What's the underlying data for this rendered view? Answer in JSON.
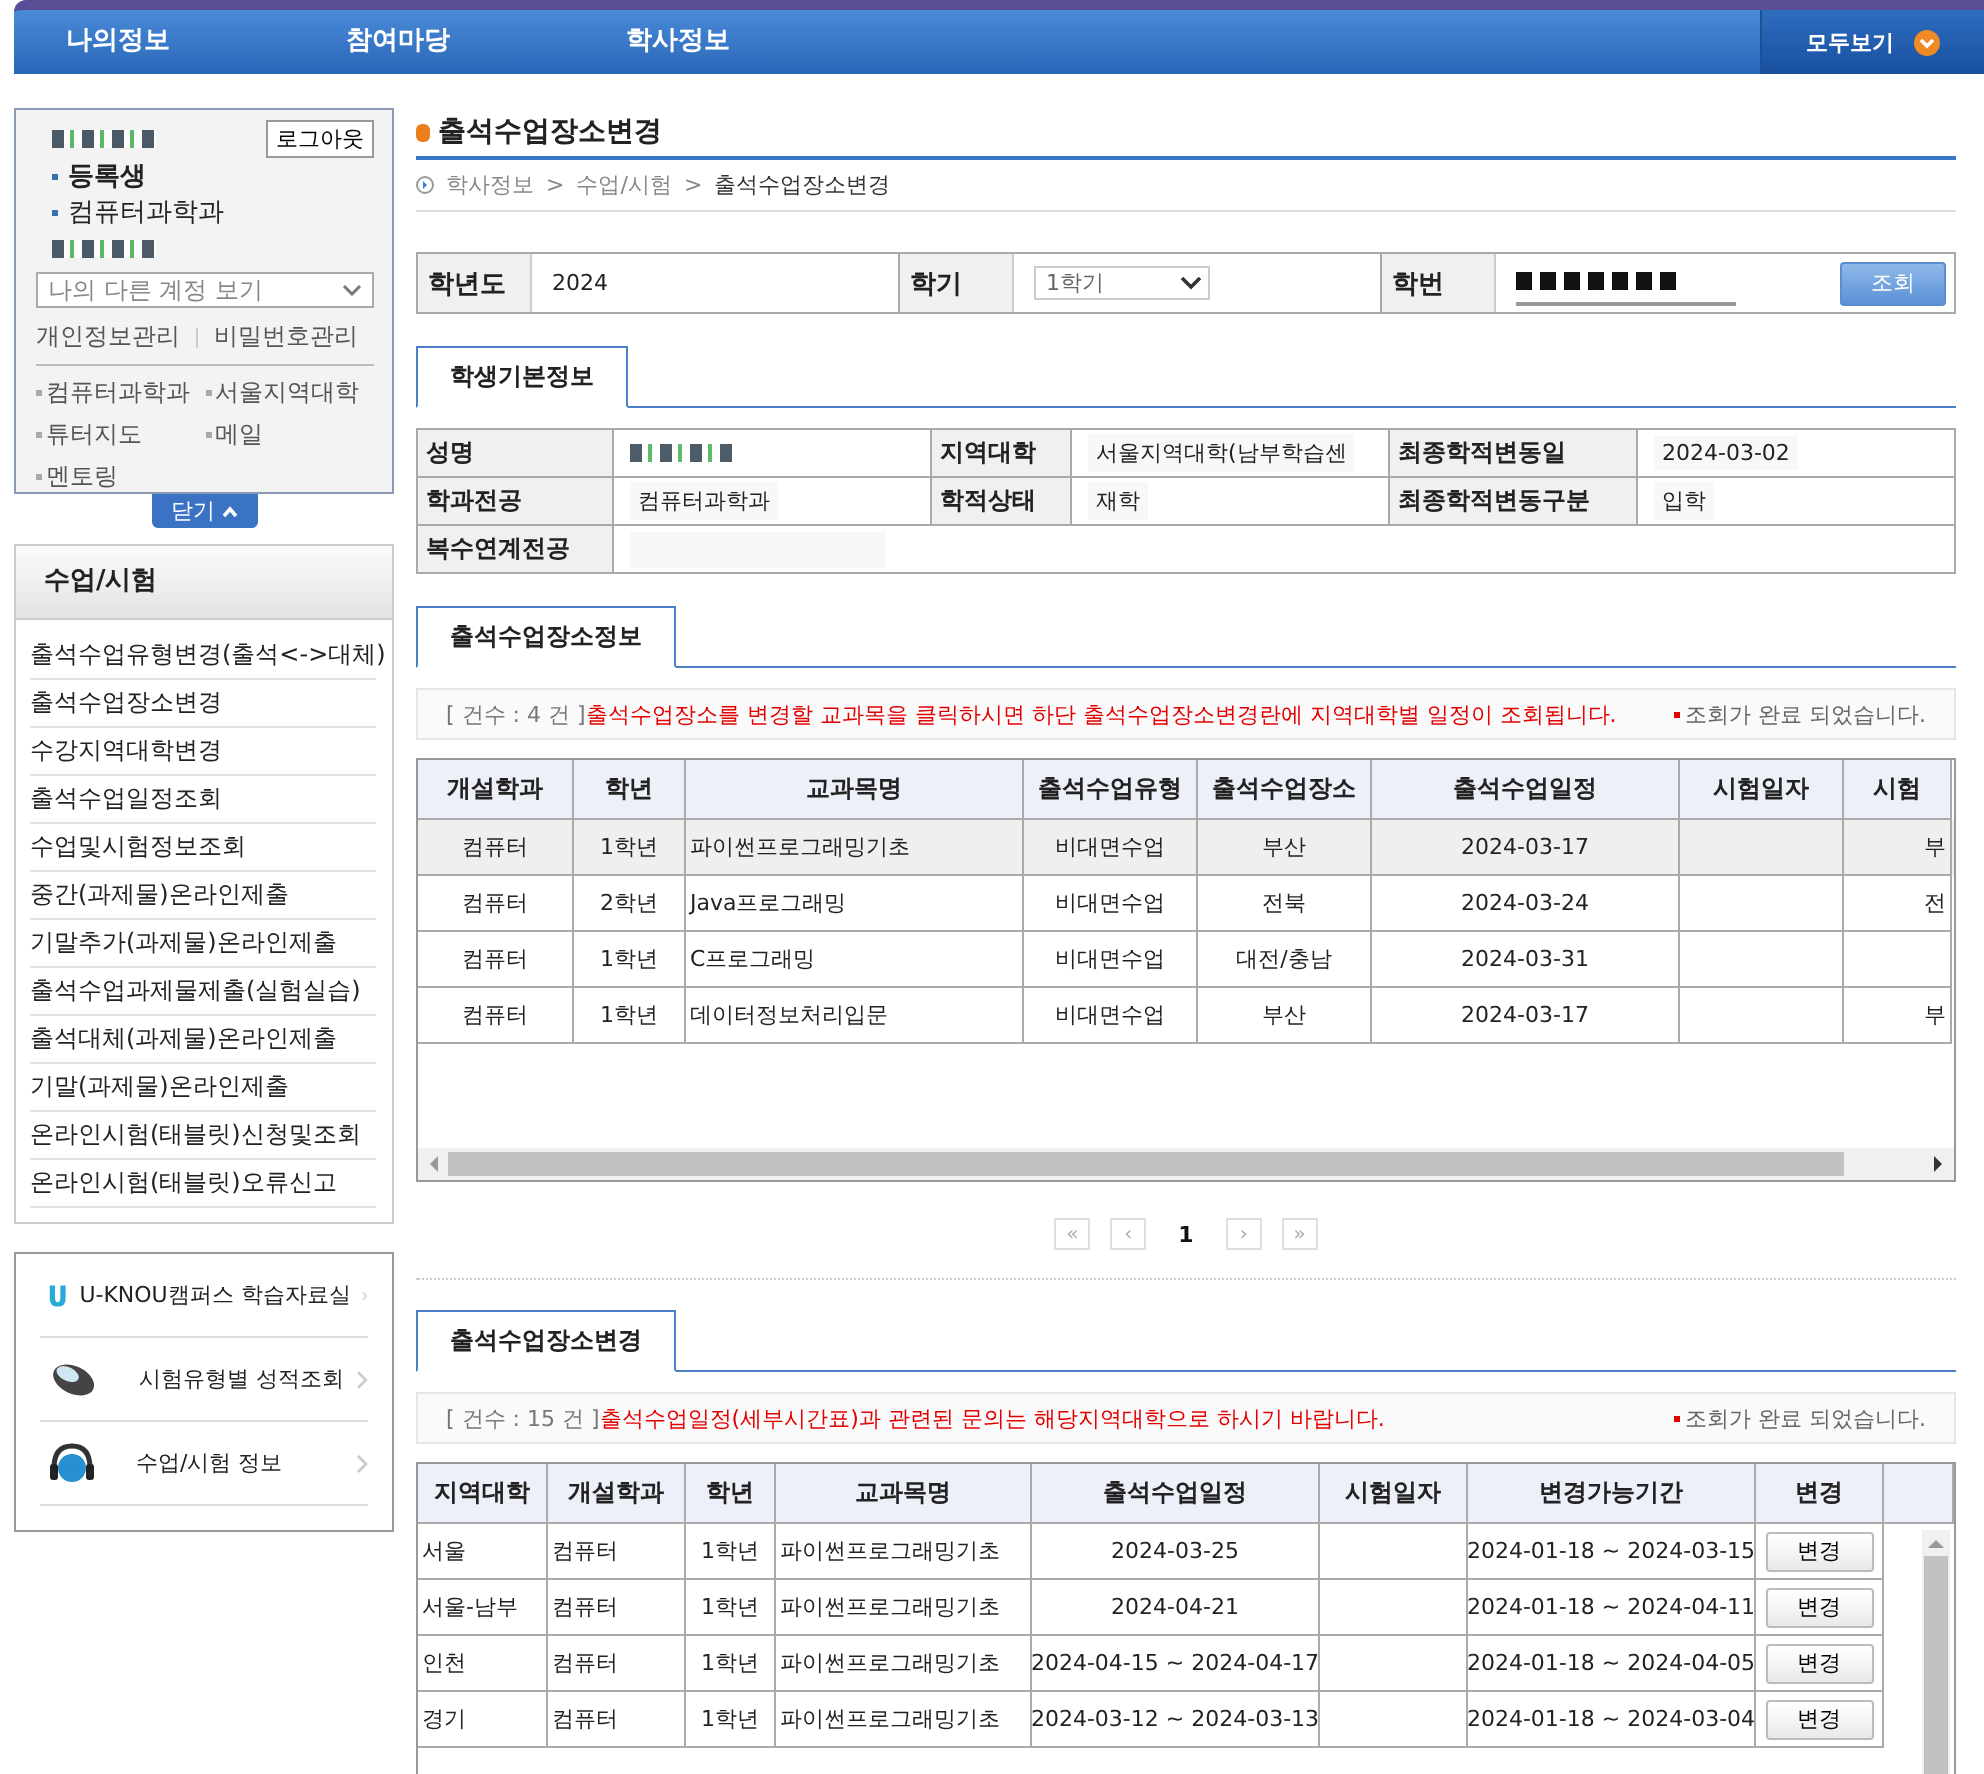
{
  "top_nav": {
    "items": [
      {
        "label": "나의정보"
      },
      {
        "label": "참여마당"
      },
      {
        "label": "학사정보"
      }
    ],
    "all_button": "모두보기"
  },
  "user_box": {
    "logout": "로그아웃",
    "status": "등록생",
    "department": "컴퓨터과학과",
    "account_select": "나의 다른 계정 보기",
    "account_links": [
      "개인정보관리",
      "비밀번호관리"
    ],
    "links": [
      "컴퓨터과학과",
      "서울지역대학",
      "튜터지도",
      "메일",
      "멘토링"
    ],
    "close_button": "닫기"
  },
  "menu": {
    "title": "수업/시험",
    "items": [
      "출석수업유형변경(출석<->대체)",
      "출석수업장소변경",
      "수강지역대학변경",
      "출석수업일정조회",
      "수업및시험정보조회",
      "중간(과제물)온라인제출",
      "기말추가(과제물)온라인제출",
      "출석수업과제물제출(실험실습)",
      "출석대체(과제물)온라인제출",
      "기말(과제물)온라인제출",
      "온라인시험(태블릿)신청및조회",
      "온라인시험(태블릿)오류신고"
    ]
  },
  "quick_links": [
    {
      "kind": "campus",
      "label": "U-KNOU캠퍼스 학습자료실"
    },
    {
      "kind": "grades",
      "label": "시험유형별 성적조회"
    },
    {
      "kind": "info",
      "label": "수업/시험 정보"
    }
  ],
  "page": {
    "title": "출석수업장소변경",
    "breadcrumb": [
      "학사정보",
      "수업/시험",
      "출석수업장소변경"
    ],
    "breadcrumb_separator": ">"
  },
  "search": {
    "fields": [
      {
        "label": "학년도",
        "kind": "text",
        "value": "2024"
      },
      {
        "label": "학기",
        "kind": "select",
        "value": "1학기"
      },
      {
        "label": "학번",
        "kind": "redacted"
      }
    ],
    "button": "조회"
  },
  "student_tab": "학생기본정보",
  "student_info": [
    {
      "label": "성명",
      "redacted": true
    },
    {
      "label": "지역대학",
      "value": "서울지역대학(남부학습센",
      "redacted": false
    },
    {
      "label": "최종학적변동일",
      "value": "2024-03-02",
      "redacted": false
    },
    {
      "label": "학과전공",
      "value": "컴퓨터과학과",
      "redacted": false
    },
    {
      "label": "학적상태",
      "value": "재학",
      "redacted": false
    },
    {
      "label": "최종학적변동구분",
      "value": "입학",
      "redacted": false
    },
    {
      "label": "복수연계전공",
      "redacted": false
    }
  ],
  "location_info": {
    "tab": "출석수업장소정보",
    "notice": {
      "count": "[ 건수 : 4 건 ]",
      "message": "출석수업장소를 변경할 교과목을 클릭하시면 하단 출석수업장소변경란에 지역대학별 일정이 조회됩니다.",
      "status": "조회가 완료 되었습니다."
    },
    "columns": [
      "개설학과",
      "학년",
      "교과목명",
      "출석수업유형",
      "출석수업장소",
      "출석수업일정",
      "시험일자",
      "시험"
    ],
    "rows": [
      {
        "selected": true,
        "cells": [
          "컴퓨터",
          "1학년",
          "파이썬프로그래밍기초",
          "비대면수업",
          "부산",
          "2024-03-17",
          "",
          "부"
        ]
      },
      {
        "selected": false,
        "cells": [
          "컴퓨터",
          "2학년",
          "Java프로그래밍",
          "비대면수업",
          "전북",
          "2024-03-24",
          "",
          "전"
        ]
      },
      {
        "selected": false,
        "cells": [
          "컴퓨터",
          "1학년",
          "C프로그래밍",
          "비대면수업",
          "대전/충남",
          "2024-03-31",
          "",
          ""
        ]
      },
      {
        "selected": false,
        "cells": [
          "컴퓨터",
          "1학년",
          "데이터정보처리입문",
          "비대면수업",
          "부산",
          "2024-03-17",
          "",
          "부"
        ]
      }
    ],
    "pagination": {
      "first": "«",
      "prev": "‹",
      "next": "›",
      "last": "»",
      "pages": [
        {
          "label": "1",
          "selected": true
        }
      ]
    }
  },
  "location_change": {
    "tab": "출석수업장소변경",
    "notice": {
      "count": "[ 건수 : 15 건 ]",
      "message": "출석수업일정(세부시간표)과 관련된 문의는 해당지역대학으로 하시기 바랍니다.",
      "status": "조회가 완료 되었습니다."
    },
    "columns": [
      "지역대학",
      "개설학과",
      "학년",
      "교과목명",
      "출석수업일정",
      "시험일자",
      "변경가능기간",
      "변경"
    ],
    "rows": [
      {
        "cells": [
          "서울",
          "컴퓨터",
          "1학년",
          "파이썬프로그래밍기초",
          "2024-03-25",
          "",
          "2024-01-18 ~ 2024-03-15"
        ],
        "button": "변경"
      },
      {
        "cells": [
          "서울-남부",
          "컴퓨터",
          "1학년",
          "파이썬프로그래밍기초",
          "2024-04-21",
          "",
          "2024-01-18 ~ 2024-04-11"
        ],
        "button": "변경"
      },
      {
        "cells": [
          "인천",
          "컴퓨터",
          "1학년",
          "파이썬프로그래밍기초",
          "2024-04-15 ~ 2024-04-17",
          "",
          "2024-01-18 ~ 2024-04-05"
        ],
        "button": "변경"
      },
      {
        "cells": [
          "경기",
          "컴퓨터",
          "1학년",
          "파이썬프로그래밍기초",
          "2024-03-12 ~ 2024-03-13",
          "",
          "2024-01-18 ~ 2024-03-04"
        ],
        "button": "변경"
      }
    ]
  }
}
